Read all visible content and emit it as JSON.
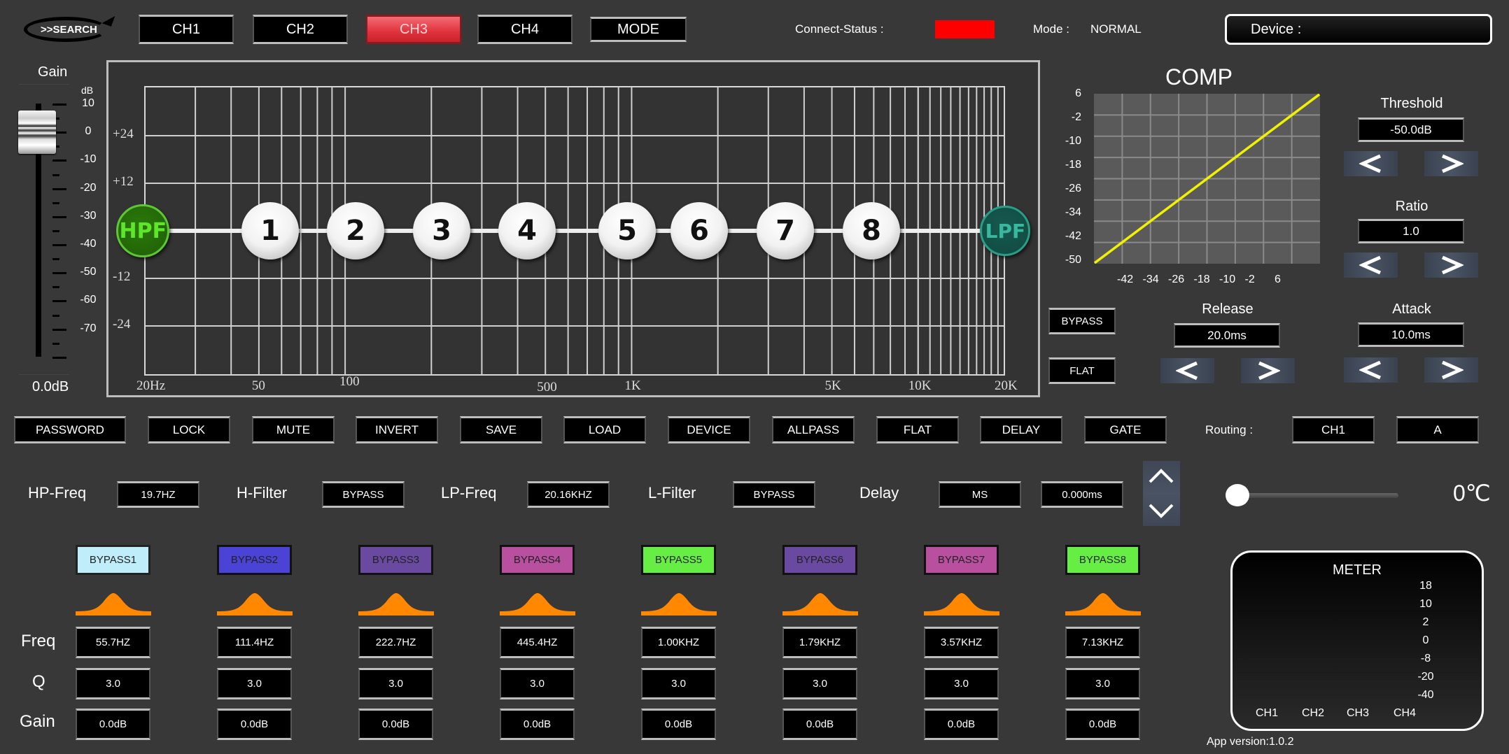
{
  "top_bar": {
    "search_label": ">>SEARCH",
    "channels": [
      {
        "label": "CH1",
        "active": false
      },
      {
        "label": "CH2",
        "active": false
      },
      {
        "label": "CH3",
        "active": true
      },
      {
        "label": "CH4",
        "active": false
      }
    ],
    "mode_button": "MODE",
    "connect_status_label": "Connect-Status :",
    "connect_status_color": "#ff0000",
    "mode_label": "Mode :",
    "mode_value": "NORMAL",
    "device_label": "Device :"
  },
  "gain_fader": {
    "title": "Gain",
    "unit": "dB",
    "scale": [
      "10",
      "0",
      "-10",
      "-20",
      "-30",
      "-40",
      "-50",
      "-60",
      "-70"
    ],
    "value": "0.0dB",
    "level_db": 0
  },
  "eq_graph": {
    "y_labels": [
      "+24",
      "+12",
      "-12",
      "-24"
    ],
    "x_labels": [
      "20Hz",
      "50",
      "100",
      "500",
      "1K",
      "5K",
      "10K",
      "20K"
    ],
    "nodes": [
      {
        "label": "HPF",
        "type": "hpf",
        "freq": 19.7,
        "gain": 0
      },
      {
        "label": "1",
        "type": "peq",
        "freq": 55.7,
        "gain": 0
      },
      {
        "label": "2",
        "type": "peq",
        "freq": 111.4,
        "gain": 0
      },
      {
        "label": "3",
        "type": "peq",
        "freq": 222.7,
        "gain": 0
      },
      {
        "label": "4",
        "type": "peq",
        "freq": 445.4,
        "gain": 0
      },
      {
        "label": "5",
        "type": "peq",
        "freq": 1000,
        "gain": 0
      },
      {
        "label": "6",
        "type": "peq",
        "freq": 1790,
        "gain": 0
      },
      {
        "label": "7",
        "type": "peq",
        "freq": 3570,
        "gain": 0
      },
      {
        "label": "8",
        "type": "peq",
        "freq": 7130,
        "gain": 0
      },
      {
        "label": "LPF",
        "type": "lpf",
        "freq": 20160,
        "gain": 0
      }
    ]
  },
  "comp": {
    "title": "COMP",
    "y_labels": [
      "6",
      "-2",
      "-10",
      "-18",
      "-26",
      "-34",
      "-42",
      "-50"
    ],
    "x_labels": [
      "-42",
      "-34",
      "-26",
      "-18",
      "-10",
      "-2",
      "6"
    ],
    "line_color": "#f2f200",
    "threshold": {
      "label": "Threshold",
      "value": "-50.0dB"
    },
    "ratio": {
      "label": "Ratio",
      "value": "1.0"
    },
    "release": {
      "label": "Release",
      "value": "20.0ms"
    },
    "attack": {
      "label": "Attack",
      "value": "10.0ms"
    },
    "bypass_button": "BYPASS",
    "flat_button": "FLAT",
    "prev_icon": "<",
    "next_icon": ">"
  },
  "function_buttons": [
    "PASSWORD",
    "LOCK",
    "MUTE",
    "INVERT",
    "SAVE",
    "LOAD",
    "DEVICE",
    "ALLPASS",
    "FLAT",
    "DELAY",
    "GATE"
  ],
  "routing": {
    "label": "Routing :",
    "channel": "CH1",
    "output": "A"
  },
  "filters": {
    "hp_freq_label": "HP-Freq",
    "hp_freq_value": "19.7HZ",
    "h_filter_label": "H-Filter",
    "h_filter_value": "BYPASS",
    "lp_freq_label": "LP-Freq",
    "lp_freq_value": "20.16KHZ",
    "l_filter_label": "L-Filter",
    "l_filter_value": "BYPASS",
    "delay_label": "Delay",
    "delay_unit": "MS",
    "delay_value": "0.000ms"
  },
  "temperature": {
    "value": "0℃",
    "slider_fraction": 0
  },
  "bands": {
    "row_labels": {
      "freq": "Freq",
      "q": "Q",
      "gain": "Gain"
    },
    "items": [
      {
        "bypass": "BYPASS1",
        "color": "#bfeefa",
        "freq": "55.7HZ",
        "q": "3.0",
        "gain": "0.0dB"
      },
      {
        "bypass": "BYPASS2",
        "color": "#4a43d6",
        "freq": "111.4HZ",
        "q": "3.0",
        "gain": "0.0dB"
      },
      {
        "bypass": "BYPASS3",
        "color": "#6a4aa0",
        "freq": "222.7HZ",
        "q": "3.0",
        "gain": "0.0dB"
      },
      {
        "bypass": "BYPASS4",
        "color": "#b84f9f",
        "freq": "445.4HZ",
        "q": "3.0",
        "gain": "0.0dB"
      },
      {
        "bypass": "BYPASS5",
        "color": "#66ee44",
        "freq": "1.00KHZ",
        "q": "3.0",
        "gain": "0.0dB"
      },
      {
        "bypass": "BYPASS6",
        "color": "#6a4aa0",
        "freq": "1.79KHZ",
        "q": "3.0",
        "gain": "0.0dB"
      },
      {
        "bypass": "BYPASS7",
        "color": "#b84f9f",
        "freq": "3.57KHZ",
        "q": "3.0",
        "gain": "0.0dB"
      },
      {
        "bypass": "BYPASS8",
        "color": "#66ee44",
        "freq": "7.13KHZ",
        "q": "3.0",
        "gain": "0.0dB"
      }
    ],
    "shape_color": "#ff8800"
  },
  "meter": {
    "title": "METER",
    "scale": [
      "18",
      "10",
      "2",
      "0",
      "-8",
      "-20",
      "-40"
    ],
    "channels": [
      "CH1",
      "CH2",
      "CH3",
      "CH4"
    ]
  },
  "footer": {
    "app_version": "App version:1.0.2"
  }
}
